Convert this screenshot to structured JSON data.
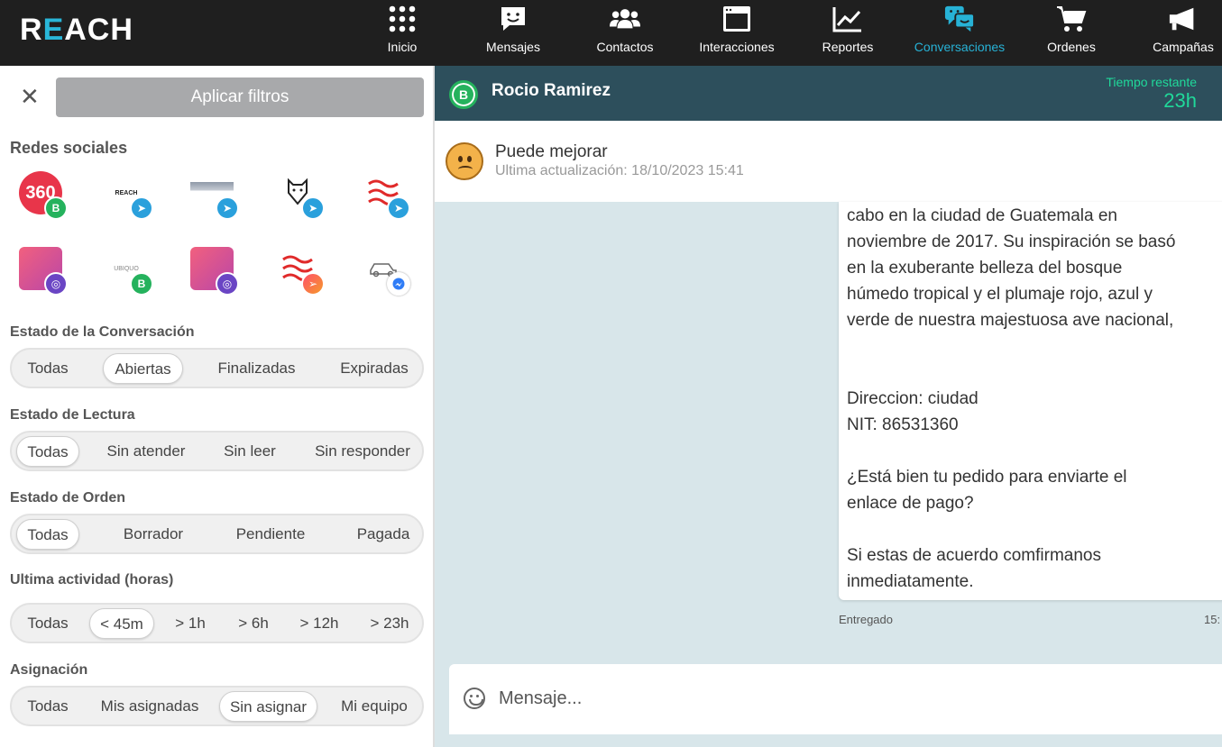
{
  "app": {
    "logo": "REACH"
  },
  "nav": [
    {
      "label": "Inicio",
      "icon": "grid-icon"
    },
    {
      "label": "Mensajes",
      "icon": "message-icon"
    },
    {
      "label": "Contactos",
      "icon": "contacts-icon"
    },
    {
      "label": "Interacciones",
      "icon": "window-icon"
    },
    {
      "label": "Reportes",
      "icon": "chart-icon"
    },
    {
      "label": "Conversaciones",
      "icon": "chat-bubbles-icon",
      "active": true
    },
    {
      "label": "Ordenes",
      "icon": "cart-icon"
    },
    {
      "label": "Campañas",
      "icon": "megaphone-icon"
    }
  ],
  "filters": {
    "apply_label": "Aplicar filtros",
    "social_title": "Redes sociales",
    "social_networks": [
      {
        "logo_text": "360",
        "badge": "whatsapp"
      },
      {
        "logo_text": "REACH",
        "badge": "telegram"
      },
      {
        "logo_text": "",
        "badge": "telegram"
      },
      {
        "logo_text": "",
        "badge": "telegram"
      },
      {
        "logo_text": "",
        "badge": "telegram"
      },
      {
        "logo_text": "",
        "badge": "web"
      },
      {
        "logo_text": "UBIQUO",
        "badge": "whatsapp"
      },
      {
        "logo_text": "",
        "badge": "web"
      },
      {
        "logo_text": "",
        "badge": "flow"
      },
      {
        "logo_text": "",
        "badge": "messenger"
      }
    ],
    "conversation_state": {
      "title": "Estado de la Conversación",
      "options": [
        "Todas",
        "Abiertas",
        "Finalizadas",
        "Expiradas"
      ],
      "selected": "Abiertas"
    },
    "read_state": {
      "title": "Estado de Lectura",
      "options": [
        "Todas",
        "Sin atender",
        "Sin leer",
        "Sin responder"
      ],
      "selected": "Todas"
    },
    "order_state": {
      "title": "Estado de Orden",
      "options": [
        "Todas",
        "Borrador",
        "Pendiente",
        "Pagada"
      ],
      "selected": "Todas"
    },
    "last_activity": {
      "title": "Ultima actividad (horas)",
      "options": [
        "Todas",
        "< 45m",
        "> 1h",
        "> 6h",
        "> 12h",
        "> 23h"
      ],
      "selected": "< 45m"
    },
    "assignment": {
      "title": "Asignación",
      "options": [
        "Todas",
        "Mis asignadas",
        "Sin asignar",
        "Mi equipo"
      ],
      "selected": "Sin asignar"
    }
  },
  "chat": {
    "contact_name": "Rocio Ramirez",
    "remaining_label": "Tiempo restante",
    "remaining_value": "23h",
    "rating_title": "Puede mejorar",
    "rating_updated": "Ultima actualización: 18/10/2023 15:41",
    "message_text": "cabo en la ciudad de Guatemala en\nnoviembre de 2017. Su inspiración se basó\nen la exuberante belleza del bosque\nhúmedo tropical y el plumaje rojo, azul y\nverde de nuestra majestuosa ave nacional,\n\n\nDireccion: ciudad\nNIT: 86531360\n\n¿Está bien tu pedido para enviarte el\nenlace de pago?\n\nSi estas de acuerdo comfirmanos\ninmediatamente.",
    "message_status": "Entregado",
    "message_time": "15:",
    "composer_placeholder": "Mensaje..."
  },
  "colors": {
    "accent": "#27b2d6",
    "header_bg": "#2d4f5c",
    "chat_bg": "#d8e6ea",
    "remaining": "#20d99a"
  }
}
